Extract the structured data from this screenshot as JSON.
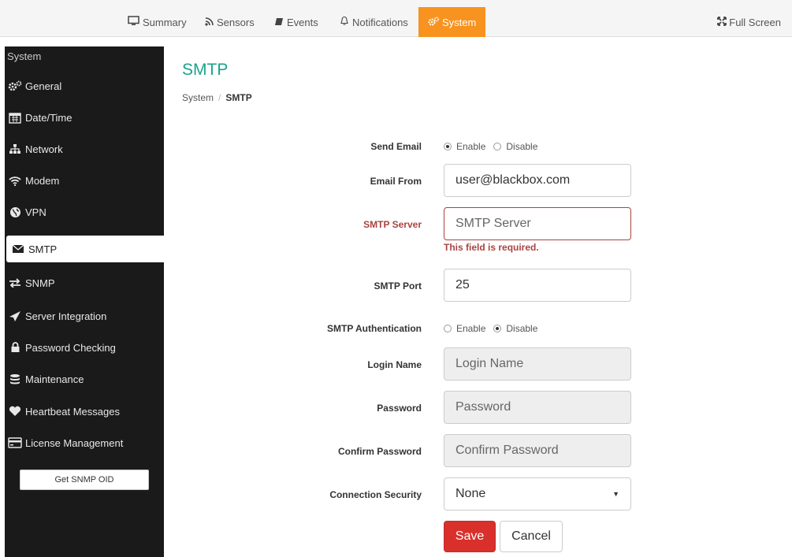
{
  "nav": {
    "tabs": [
      {
        "label": "Summary",
        "icon": "monitor-icon"
      },
      {
        "label": "Sensors",
        "icon": "rss-icon"
      },
      {
        "label": "Events",
        "icon": "book-icon"
      },
      {
        "label": "Notifications",
        "icon": "bell-icon"
      },
      {
        "label": "System",
        "icon": "cogs-icon",
        "active": true
      }
    ],
    "fullscreen_label": "Full Screen",
    "active_color": "#f7931e"
  },
  "sidebar": {
    "title": "System",
    "items": [
      {
        "label": "General",
        "icon": "cogs-icon"
      },
      {
        "label": "Date/Time",
        "icon": "calendar-icon"
      },
      {
        "label": "Network",
        "icon": "sitemap-icon"
      },
      {
        "label": "Modem",
        "icon": "wifi-icon"
      },
      {
        "label": "VPN",
        "icon": "globe-icon"
      },
      {
        "label": "SMTP",
        "icon": "envelope-icon",
        "active": true
      },
      {
        "label": "SNMP",
        "icon": "exchange-icon"
      },
      {
        "label": "Server Integration",
        "icon": "paper-plane-icon"
      },
      {
        "label": "Password Checking",
        "icon": "lock-icon"
      },
      {
        "label": "Maintenance",
        "icon": "database-icon"
      },
      {
        "label": "Heartbeat Messages",
        "icon": "heart-icon"
      },
      {
        "label": "License Management",
        "icon": "credit-card-icon"
      }
    ],
    "oid_button": "Get SNMP OID"
  },
  "main": {
    "title": "SMTP",
    "title_color": "#1aa38c",
    "breadcrumb": {
      "parent": "System",
      "sep": "/",
      "current": "SMTP"
    }
  },
  "form": {
    "send_email": {
      "label": "Send Email",
      "options": [
        "Enable",
        "Disable"
      ],
      "selected": "Enable"
    },
    "email_from": {
      "label": "Email From",
      "value": "user@blackbox.com"
    },
    "smtp_server": {
      "label": "SMTP Server",
      "placeholder": "SMTP Server",
      "error": "This field is required."
    },
    "smtp_port": {
      "label": "SMTP Port",
      "value": "25"
    },
    "smtp_auth": {
      "label": "SMTP Authentication",
      "options": [
        "Enable",
        "Disable"
      ],
      "selected": "Disable"
    },
    "login_name": {
      "label": "Login Name",
      "placeholder": "Login Name"
    },
    "password": {
      "label": "Password",
      "placeholder": "Password"
    },
    "confirm_password": {
      "label": "Confirm Password",
      "placeholder": "Confirm Password"
    },
    "connection_security": {
      "label": "Connection Security",
      "value": "None"
    },
    "save_label": "Save",
    "cancel_label": "Cancel",
    "error_color": "#a94442",
    "save_color": "#d9302c"
  }
}
